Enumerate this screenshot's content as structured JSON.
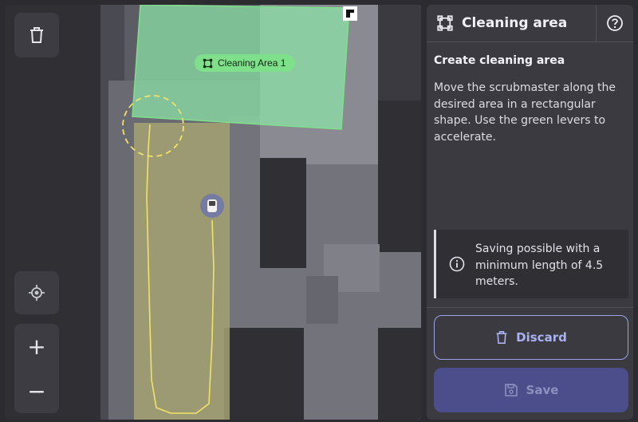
{
  "map": {
    "area_label": "Cleaning Area 1",
    "area_color": "#7fe08c",
    "path_color": "#f0e26a",
    "controls": {
      "trash_icon": "trash-icon",
      "locate_icon": "locate-icon",
      "zoom_in": "+",
      "zoom_out": "−"
    }
  },
  "panel": {
    "title": "Cleaning area",
    "title_icon": "area-icon",
    "help_icon": "help-icon",
    "subtitle": "Create cleaning area",
    "description": "Move the scrubmaster along the desired area in a rectangular shape. Use the green levers to accelerate.",
    "info": "Saving possible with a minimum length of 4.5 meters.",
    "discard_label": "Discard",
    "save_label": "Save",
    "accent": "#9aa3e6"
  }
}
